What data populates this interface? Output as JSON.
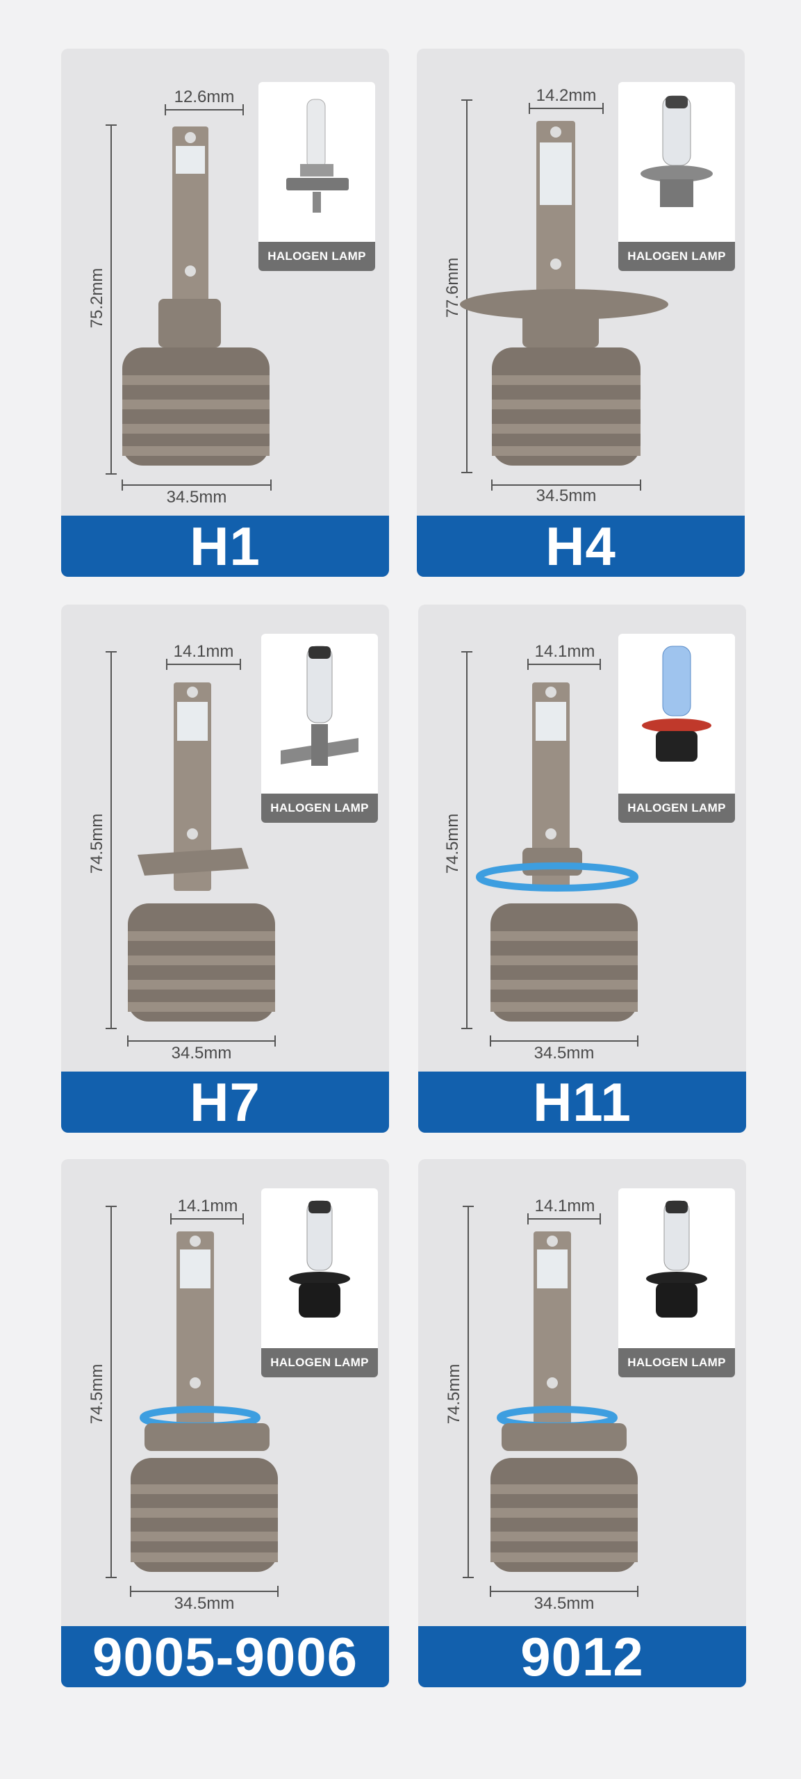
{
  "halogen_label": "HALOGEN LAMP",
  "colors": {
    "label_bar": "#1260ad",
    "card": "#e4e4e6",
    "bulb_body": "#8a8076",
    "blue_ring": "#3d9ee0"
  },
  "cards": [
    {
      "model": "H1",
      "top_width": "12.6mm",
      "height": "75.2mm",
      "base_width": "34.5mm",
      "collar": "none"
    },
    {
      "model": "H4",
      "top_width": "14.2mm",
      "height": "77.6mm",
      "base_width": "34.5mm",
      "collar": "flange"
    },
    {
      "model": "H7",
      "top_width": "14.1mm",
      "height": "74.5mm",
      "base_width": "34.5mm",
      "collar": "tab"
    },
    {
      "model": "H11",
      "top_width": "14.1mm",
      "height": "74.5mm",
      "base_width": "34.5mm",
      "collar": "blue-ring"
    },
    {
      "model": "9005-9006",
      "top_width": "14.1mm",
      "height": "74.5mm",
      "base_width": "34.5mm",
      "collar": "blue-ring"
    },
    {
      "model": "9012",
      "top_width": "14.1mm",
      "height": "74.5mm",
      "base_width": "34.5mm",
      "collar": "blue-ring"
    }
  ]
}
